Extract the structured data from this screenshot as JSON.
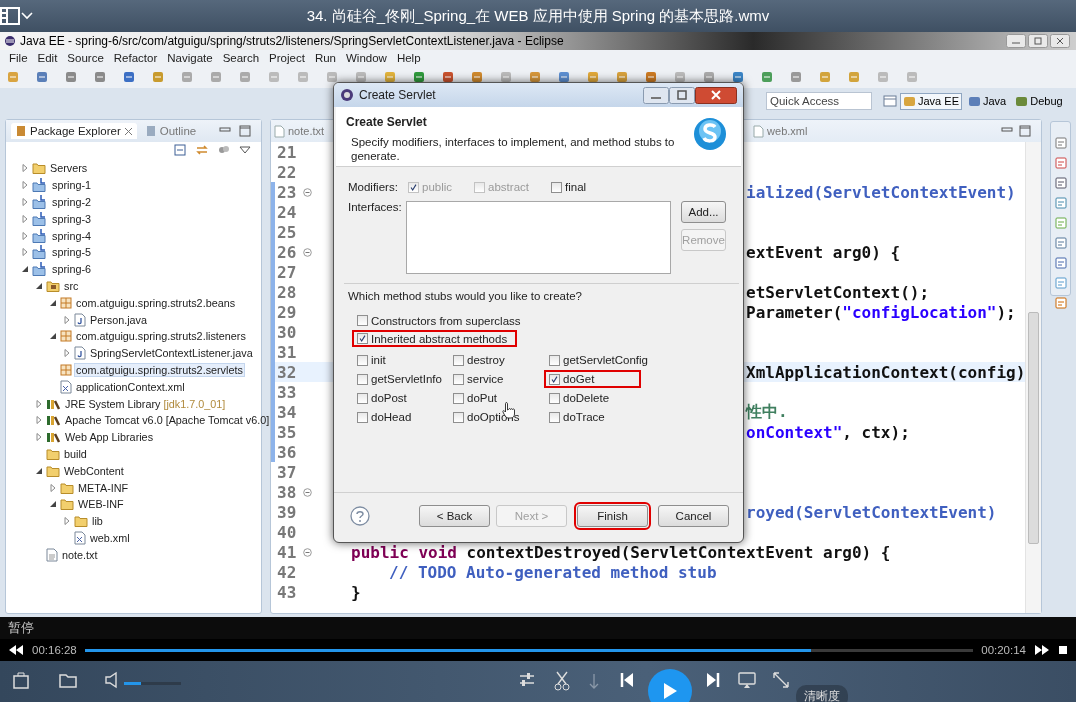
{
  "player": {
    "title": "34. 尚硅谷_佟刚_Spring_在 WEB 应用中使用 Spring 的基本思路.wmv",
    "status": "暂停",
    "elapsed": "00:16:28",
    "duration": "00:20:14",
    "progress": {
      "level": 0.817
    },
    "volume": {
      "level": 0.3
    },
    "quality_button": "清晰度"
  },
  "eclipse": {
    "title": "Java EE - spring-6/src/com/atguigu/spring/struts2/listeners/SpringServletContextListener.java - Eclipse",
    "menu": [
      "File",
      "Edit",
      "Source",
      "Refactor",
      "Navigate",
      "Search",
      "Project",
      "Run",
      "Window",
      "Help"
    ],
    "quick_access": {
      "placeholder": "Quick Access"
    },
    "perspectives": [
      {
        "label": "Java EE",
        "selected": true
      },
      {
        "label": "Java",
        "selected": false
      },
      {
        "label": "Debug",
        "selected": false
      }
    ],
    "package_explorer": {
      "tabs": [
        {
          "label": "Package Explorer",
          "selected": true
        },
        {
          "label": "Outline",
          "selected": false
        }
      ],
      "tree": [
        {
          "label": "Servers",
          "kind": "folder",
          "expanded": false,
          "selected": false
        },
        {
          "label": "spring-1",
          "kind": "project",
          "expanded": false,
          "selected": false
        },
        {
          "label": "spring-2",
          "kind": "project",
          "expanded": false,
          "selected": false
        },
        {
          "label": "spring-3",
          "kind": "project",
          "expanded": false,
          "selected": false
        },
        {
          "label": "spring-4",
          "kind": "project",
          "expanded": false,
          "selected": false
        },
        {
          "label": "spring-5",
          "kind": "project",
          "expanded": false,
          "selected": false
        },
        {
          "label": "spring-6",
          "kind": "project",
          "expanded": true,
          "selected": false,
          "children": [
            {
              "label": "src",
              "kind": "source",
              "expanded": true,
              "selected": false,
              "children": [
                {
                  "label": "com.atguigu.spring.struts2.beans",
                  "kind": "package",
                  "expanded": true,
                  "selected": false,
                  "children": [
                    {
                      "label": "Person.java",
                      "kind": "java",
                      "expanded": false,
                      "selected": false
                    }
                  ]
                },
                {
                  "label": "com.atguigu.spring.struts2.listeners",
                  "kind": "package",
                  "expanded": true,
                  "selected": false,
                  "children": [
                    {
                      "label": "SpringServletContextListener.java",
                      "kind": "java",
                      "expanded": false,
                      "selected": false
                    }
                  ]
                },
                {
                  "label": "com.atguigu.spring.struts2.servlets",
                  "kind": "package",
                  "selected": true
                },
                {
                  "label": "applicationContext.xml",
                  "kind": "xml",
                  "selected": false
                }
              ]
            },
            {
              "label": "JRE System Library",
              "decoration": "[jdk1.7.0_01]",
              "kind": "library",
              "expanded": false,
              "selected": false
            },
            {
              "label": "Apache Tomcat v6.0 [Apache Tomcat v6.0]",
              "kind": "library",
              "expanded": false,
              "selected": false
            },
            {
              "label": "Web App Libraries",
              "kind": "library",
              "expanded": false,
              "selected": false
            },
            {
              "label": "build",
              "kind": "folder",
              "selected": false
            },
            {
              "label": "WebContent",
              "kind": "folder",
              "expanded": true,
              "selected": false,
              "children": [
                {
                  "label": "META-INF",
                  "kind": "folder",
                  "expanded": false,
                  "selected": false
                },
                {
                  "label": "WEB-INF",
                  "kind": "folder",
                  "expanded": true,
                  "selected": false,
                  "children": [
                    {
                      "label": "lib",
                      "kind": "folder",
                      "expanded": false,
                      "selected": false
                    },
                    {
                      "label": "web.xml",
                      "kind": "xml",
                      "selected": false
                    }
                  ]
                }
              ]
            },
            {
              "label": "note.txt",
              "kind": "file",
              "selected": false
            }
          ]
        }
      ]
    },
    "editor": {
      "tabs": [
        {
          "label": "note.txt"
        },
        {
          "label": "web.xml"
        }
      ],
      "lines": [
        {
          "number": "21",
          "fold": false,
          "range": false,
          "current": false
        },
        {
          "number": "22",
          "fold": false,
          "range": false,
          "current": false
        },
        {
          "number": "23",
          "fold": true,
          "range": true,
          "current": false,
          "kind": "fragment",
          "segments": [
            {
              "kind": "doc",
              "text": "ialized(ServletContextEvent)"
            }
          ]
        },
        {
          "number": "24",
          "fold": false,
          "range": true,
          "current": false
        },
        {
          "number": "25",
          "fold": false,
          "range": true,
          "current": false
        },
        {
          "number": "26",
          "fold": true,
          "range": true,
          "current": false,
          "kind": "fragment",
          "segments": [
            {
              "kind": "plain",
              "text": "extEvent arg0) {"
            }
          ]
        },
        {
          "number": "27",
          "fold": false,
          "range": true,
          "current": false
        },
        {
          "number": "28",
          "fold": false,
          "range": true,
          "current": false,
          "kind": "fragment",
          "segments": [
            {
              "kind": "plain",
              "text": "etServletContext();"
            }
          ]
        },
        {
          "number": "29",
          "fold": false,
          "range": true,
          "current": false,
          "kind": "fragment",
          "segments": [
            {
              "kind": "plain",
              "text": "Parameter("
            },
            {
              "kind": "string",
              "text": "\"configLocation\""
            },
            {
              "kind": "plain",
              "text": ");"
            }
          ]
        },
        {
          "number": "30",
          "fold": false,
          "range": true,
          "current": false
        },
        {
          "number": "31",
          "fold": false,
          "range": true,
          "current": false
        },
        {
          "number": "32",
          "fold": false,
          "range": true,
          "current": true,
          "kind": "fragment",
          "segments": [
            {
              "kind": "plain",
              "text": "XmlApplicationContext(config)"
            }
          ]
        },
        {
          "number": "33",
          "fold": false,
          "range": true,
          "current": false
        },
        {
          "number": "34",
          "fold": false,
          "range": true,
          "current": false,
          "kind": "fragment",
          "segments": [
            {
              "kind": "comment",
              "text": "性中."
            }
          ]
        },
        {
          "number": "35",
          "fold": false,
          "range": true,
          "current": false,
          "kind": "fragment",
          "segments": [
            {
              "kind": "string",
              "text": "onContext\""
            },
            {
              "kind": "plain",
              "text": ", ctx);"
            }
          ]
        },
        {
          "number": "36",
          "fold": false,
          "range": true,
          "current": false
        },
        {
          "number": "37",
          "fold": false,
          "range": false,
          "current": false
        },
        {
          "number": "38",
          "fold": true,
          "range": false,
          "current": false
        },
        {
          "number": "39",
          "fold": false,
          "range": false,
          "current": false,
          "kind": "fragment",
          "segments": [
            {
              "kind": "doc",
              "text": "royed(ServletContextEvent)"
            }
          ]
        },
        {
          "number": "40",
          "fold": false,
          "range": false,
          "current": false
        },
        {
          "number": "41",
          "fold": true,
          "range": false,
          "current": false,
          "kind": "member",
          "segments": [
            {
              "kind": "keyword",
              "text": "public void"
            },
            {
              "kind": "plain",
              "text": " contextDestroyed(ServletContextEvent arg0) {"
            }
          ]
        },
        {
          "number": "42",
          "fold": false,
          "range": false,
          "current": false,
          "kind": "body",
          "segments": [
            {
              "kind": "doc",
              "text": "// TODO Auto-generated method stub"
            }
          ]
        },
        {
          "number": "43",
          "fold": false,
          "range": false,
          "current": false,
          "kind": "member",
          "segments": [
            {
              "kind": "plain",
              "text": "}"
            }
          ]
        }
      ]
    }
  },
  "dialog": {
    "title": "Create Servlet",
    "heading": "Create Servlet",
    "description": "Specify modifiers, interfaces to implement, and method stubs to generate.",
    "modifiers_label": "Modifiers:",
    "modifiers": [
      {
        "label": "public",
        "checked": true,
        "disabled": true
      },
      {
        "label": "abstract",
        "checked": false,
        "disabled": true
      },
      {
        "label": "final",
        "checked": false,
        "disabled": false
      }
    ],
    "interfaces_label": "Interfaces:",
    "interface_buttons": [
      {
        "label": "Add...",
        "disabled": false
      },
      {
        "label": "Remove",
        "disabled": true
      }
    ],
    "stubs_question": "Which method stubs would you like to create?",
    "options": [
      {
        "label": "Constructors from superclass",
        "checked": false,
        "highlighted": false
      },
      {
        "label": "Inherited abstract methods",
        "checked": true,
        "highlighted": true
      }
    ],
    "methods": [
      {
        "label": "init",
        "checked": false,
        "highlighted": false
      },
      {
        "label": "destroy",
        "checked": false,
        "highlighted": false
      },
      {
        "label": "getServletConfig",
        "checked": false,
        "highlighted": false
      },
      {
        "label": "getServletInfo",
        "checked": false,
        "highlighted": false
      },
      {
        "label": "service",
        "checked": false,
        "highlighted": false
      },
      {
        "label": "doGet",
        "checked": true,
        "highlighted": true
      },
      {
        "label": "doPost",
        "checked": false,
        "highlighted": false
      },
      {
        "label": "doPut",
        "checked": false,
        "highlighted": false
      },
      {
        "label": "doDelete",
        "checked": false,
        "highlighted": false
      },
      {
        "label": "doHead",
        "checked": false,
        "highlighted": false
      },
      {
        "label": "doOptions",
        "checked": false,
        "highlighted": false
      },
      {
        "label": "doTrace",
        "checked": false,
        "highlighted": false
      }
    ],
    "buttons": [
      {
        "label": "< Back",
        "disabled": false,
        "highlighted": false
      },
      {
        "label": "Next >",
        "disabled": true,
        "highlighted": false
      },
      {
        "label": "Finish",
        "disabled": false,
        "highlighted": true
      },
      {
        "label": "Cancel",
        "disabled": false,
        "highlighted": false
      }
    ]
  }
}
